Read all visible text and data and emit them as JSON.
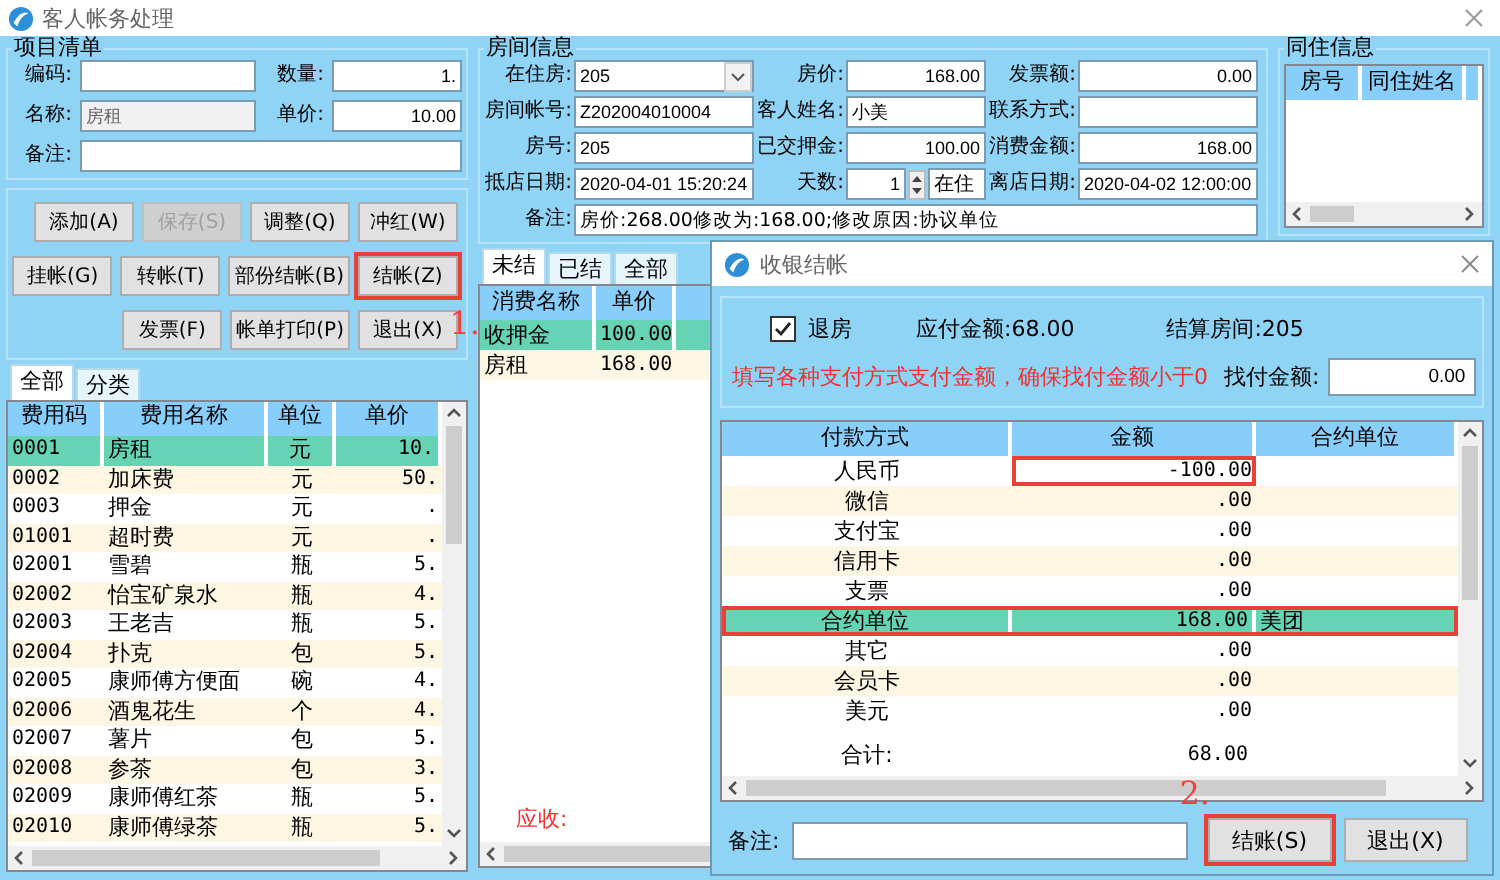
{
  "window": {
    "title": "客人帐务处理"
  },
  "item_list": {
    "title": "项目清单",
    "fields": [
      {
        "label": "编码:",
        "disabled": false
      },
      {
        "label": "数量:",
        "value": "1.",
        "disabled": false
      },
      {
        "label": "名称:",
        "value": "房租",
        "disabled": true
      },
      {
        "label": "单价:",
        "value": "10.00",
        "disabled": false
      },
      {
        "label": "备注:",
        "disabled": false
      }
    ]
  },
  "item_button_rows": [
    {
      "buttons": [
        {
          "label": "添加(A)",
          "disabled": false,
          "highlighted": false
        },
        {
          "label": "保存(S)",
          "disabled": true,
          "highlighted": false
        },
        {
          "label": "调整(Q)",
          "disabled": false,
          "highlighted": false
        },
        {
          "label": "冲红(W)",
          "disabled": false,
          "highlighted": false
        }
      ]
    },
    {
      "buttons": [
        {
          "label": "挂帐(G)",
          "disabled": false,
          "highlighted": false
        },
        {
          "label": "转帐(T)",
          "disabled": false,
          "highlighted": false
        },
        {
          "label": "部份结帐(B)",
          "disabled": false,
          "highlighted": false
        },
        {
          "label": "结帐(Z)",
          "disabled": false,
          "highlighted": true,
          "annotation": "1."
        }
      ]
    },
    {
      "buttons": [
        {
          "label": "发票(F)",
          "disabled": false,
          "highlighted": false
        },
        {
          "label": "帐单打印(P)",
          "disabled": false,
          "highlighted": false
        },
        {
          "label": "退出(X)",
          "disabled": false,
          "highlighted": false
        }
      ]
    }
  ],
  "fee_tabs": [
    {
      "label": "全部",
      "selected": true
    },
    {
      "label": "分类",
      "selected": false
    }
  ],
  "fee_table": {
    "columns": [
      "费用码",
      "费用名称",
      "单位",
      "单价"
    ],
    "rows": [
      {
        "cells": [
          "0001",
          "房租",
          "元",
          "10."
        ],
        "selected": true
      },
      {
        "cells": [
          "0002",
          "加床费",
          "元",
          "50."
        ],
        "selected": false
      },
      {
        "cells": [
          "0003",
          "押金",
          "元",
          "."
        ],
        "selected": false
      },
      {
        "cells": [
          "01001",
          "超时费",
          "元",
          "."
        ],
        "selected": false
      },
      {
        "cells": [
          "02001",
          "雪碧",
          "瓶",
          "5."
        ],
        "selected": false
      },
      {
        "cells": [
          "02002",
          "怡宝矿泉水",
          "瓶",
          "4."
        ],
        "selected": false
      },
      {
        "cells": [
          "02003",
          "王老吉",
          "瓶",
          "5."
        ],
        "selected": false
      },
      {
        "cells": [
          "02004",
          "扑克",
          "包",
          "5."
        ],
        "selected": false
      },
      {
        "cells": [
          "02005",
          "康师傅方便面",
          "碗",
          "4."
        ],
        "selected": false
      },
      {
        "cells": [
          "02006",
          "酒鬼花生",
          "个",
          "4."
        ],
        "selected": false
      },
      {
        "cells": [
          "02007",
          "薯片",
          "包",
          "5."
        ],
        "selected": false
      },
      {
        "cells": [
          "02008",
          "参茶",
          "包",
          "3."
        ],
        "selected": false
      },
      {
        "cells": [
          "02009",
          "康师傅红茶",
          "瓶",
          "5."
        ],
        "selected": false
      },
      {
        "cells": [
          "02010",
          "康师傅绿茶",
          "瓶",
          "5."
        ],
        "selected": false
      }
    ]
  },
  "room_info": {
    "title": "房间信息",
    "fields": [
      {
        "label": "在住房:",
        "value": "205",
        "kind": "dropdown"
      },
      {
        "label": "房价:",
        "value": "168.00",
        "kind": "number"
      },
      {
        "label": "发票额:",
        "value": "0.00",
        "kind": "number"
      },
      {
        "label": "房间帐号:",
        "value": "Z202004010004",
        "kind": "text"
      },
      {
        "label": "客人姓名:",
        "value": "小美",
        "kind": "text"
      },
      {
        "label": "联系方式:",
        "kind": "text"
      },
      {
        "label": "房号:",
        "value": "205",
        "kind": "text"
      },
      {
        "label": "已交押金:",
        "value": "100.00",
        "kind": "number"
      },
      {
        "label": "消费金额:",
        "value": "168.00",
        "kind": "number"
      },
      {
        "label": "抵店日期:",
        "value": "2020-04-01 15:20:24",
        "kind": "text"
      },
      {
        "label": "天数:",
        "value": "1",
        "kind": "spinner",
        "status": "在住"
      },
      {
        "label": "离店日期:",
        "value": "2020-04-02 12:00:00",
        "kind": "text"
      }
    ],
    "remark": {
      "label": "备注:",
      "value": "房价:268.00修改为:168.00;修改原因:协议单位"
    }
  },
  "consumption_tabs": [
    {
      "label": "未结",
      "selected": true
    },
    {
      "label": "已结",
      "selected": false
    },
    {
      "label": "全部",
      "selected": false
    }
  ],
  "consumption_table": {
    "columns": [
      "消费名称",
      "单价"
    ],
    "rows": [
      {
        "cells": [
          "收押金",
          "100.00"
        ],
        "selected": true
      },
      {
        "cells": [
          "房租",
          "168.00"
        ],
        "selected": false
      }
    ]
  },
  "receivable_label": "应收:",
  "cohabitants": {
    "title": "同住信息",
    "columns": [
      "房号",
      "同住姓名"
    ]
  },
  "dialog": {
    "title": "收银结帐",
    "checkout": {
      "label": "退房",
      "checked": true
    },
    "amount_due": "应付金额:68.00",
    "settle_room": "结算房间:205",
    "notice": "填写各种支付方式支付金额，确保找付金额小于0",
    "change": {
      "label": "找付金额:",
      "value": "0.00"
    },
    "columns": [
      "付款方式",
      "金额",
      "合约单位"
    ],
    "payments": [
      {
        "method": "人民币",
        "amount": "-100.00",
        "selected": false,
        "highlighted": false,
        "amount_highlighted": true
      },
      {
        "method": "微信",
        "amount": ".00",
        "selected": false,
        "highlighted": false,
        "amount_highlighted": false
      },
      {
        "method": "支付宝",
        "amount": ".00",
        "selected": false,
        "highlighted": false,
        "amount_highlighted": false
      },
      {
        "method": "信用卡",
        "amount": ".00",
        "selected": false,
        "highlighted": false,
        "amount_highlighted": false
      },
      {
        "method": "支票",
        "amount": ".00",
        "selected": false,
        "highlighted": false,
        "amount_highlighted": false
      },
      {
        "method": "合约单位",
        "amount": "168.00",
        "company": "美团",
        "selected": true,
        "highlighted": true,
        "amount_highlighted": false
      },
      {
        "method": "其它",
        "amount": ".00",
        "selected": false,
        "highlighted": false,
        "amount_highlighted": false
      },
      {
        "method": "会员卡",
        "amount": ".00",
        "selected": false,
        "highlighted": false,
        "amount_highlighted": false
      },
      {
        "method": "美元",
        "amount": ".00",
        "selected": false,
        "highlighted": false,
        "amount_highlighted": false
      }
    ],
    "total": {
      "label": "合计:",
      "value": "68.00"
    },
    "remark": {
      "label": "备注:"
    },
    "buttons": [
      {
        "label": "结账(S)",
        "highlighted": true,
        "annotation": "2."
      },
      {
        "label": "退出(X)",
        "highlighted": false
      }
    ]
  }
}
